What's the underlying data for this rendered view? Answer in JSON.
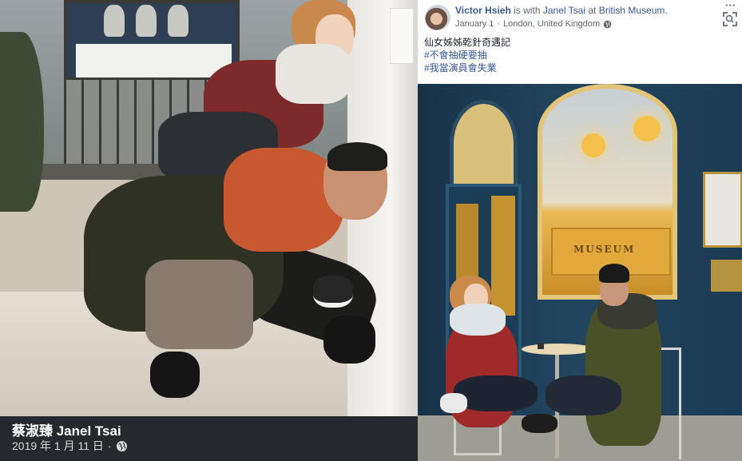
{
  "left_photo": {
    "caption": {
      "name": "蔡淑臻 Janel Tsai",
      "date": "2019 年 1 月 11 日",
      "separator": "·",
      "privacy_icon": "globe-icon"
    }
  },
  "post": {
    "author": "Victor Hsieh",
    "is_with_text": "is with",
    "tagged_person": "Janel Tsai",
    "at_text": "at",
    "place": "British Museum.",
    "date": "January 1",
    "separator": "·",
    "location": "London, United Kingdom",
    "privacy_icon": "globe-icon",
    "text": "仙女姊姊乾針奇遇記",
    "hashtags": [
      "#不會抽硬要抽",
      "#我當演員會失業"
    ],
    "more_icon": "more-dots-icon",
    "focus_icon": "visual-search-icon"
  },
  "right_photo": {
    "sign_text": "MUSEUM"
  },
  "colors": {
    "link": "#385898",
    "caption_bar": "#25282c",
    "text": "#1d2129",
    "meta": "#616770"
  }
}
